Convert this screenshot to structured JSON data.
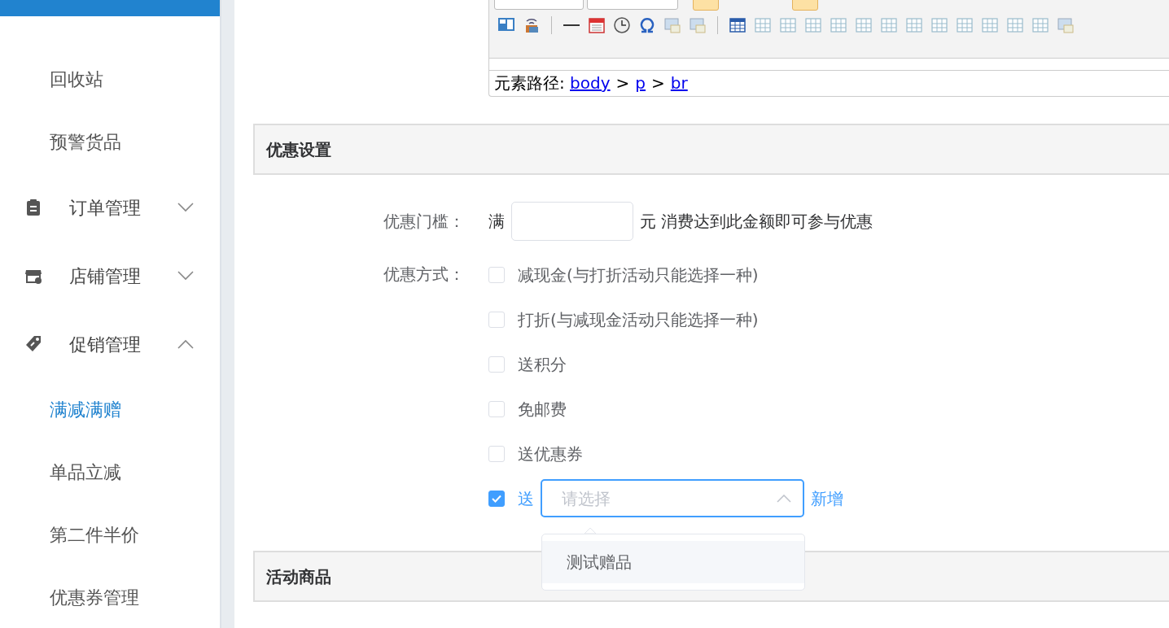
{
  "sidebar": {
    "items": [
      {
        "label": "回收站",
        "kind": "sub",
        "selected": false
      },
      {
        "label": "预警货品",
        "kind": "sub",
        "selected": false
      },
      {
        "label": "订单管理",
        "kind": "group",
        "expanded": false
      },
      {
        "label": "店铺管理",
        "kind": "group",
        "expanded": false
      },
      {
        "label": "促销管理",
        "kind": "group",
        "expanded": true
      },
      {
        "label": "满减满赠",
        "kind": "sub",
        "selected": true
      },
      {
        "label": "单品立减",
        "kind": "sub",
        "selected": false
      },
      {
        "label": "第二件半价",
        "kind": "sub",
        "selected": false
      },
      {
        "label": "优惠券管理",
        "kind": "sub",
        "selected": false
      }
    ]
  },
  "editor": {
    "path_label": "元素路径:",
    "path": [
      {
        "kind": "link",
        "text": "body"
      },
      {
        "kind": "sep",
        "text": ">"
      },
      {
        "kind": "link",
        "text": "p"
      },
      {
        "kind": "sep",
        "text": ">"
      },
      {
        "kind": "link",
        "text": "br"
      }
    ]
  },
  "sections": [
    {
      "title": "优惠设置"
    },
    {
      "title": "活动商品"
    }
  ],
  "threshold": {
    "label": "优惠门槛：",
    "prefix": "满",
    "suffix": "元 消费达到此金额即可参与优惠"
  },
  "discount": {
    "label": "优惠方式：",
    "options": [
      {
        "kind": "check",
        "label": "减现金(与打折活动只能选择一种)",
        "checked": false
      },
      {
        "kind": "check",
        "label": "打折(与减现金活动只能选择一种)",
        "checked": false
      },
      {
        "kind": "check",
        "label": "送积分",
        "checked": false
      },
      {
        "kind": "check",
        "label": "免邮费",
        "checked": false
      },
      {
        "kind": "check",
        "label": "送优惠券",
        "checked": false
      },
      {
        "kind": "gift",
        "label": "送",
        "checked": true,
        "placeholder": "请选择",
        "expanded": true,
        "options": [
          "测试赠品"
        ],
        "link": "新增"
      }
    ]
  }
}
